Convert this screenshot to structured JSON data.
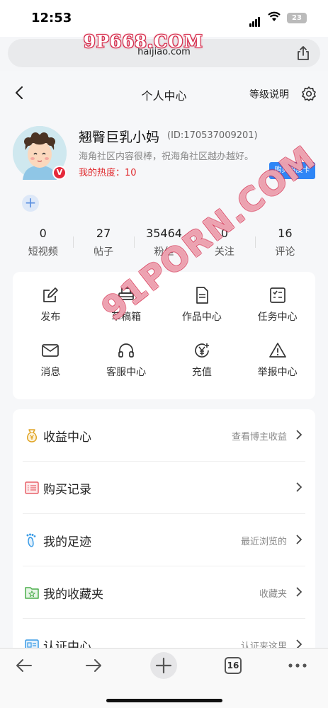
{
  "status_bar": {
    "time": "12:53",
    "battery": "23"
  },
  "browser": {
    "url": "haijiao.com",
    "watermark_top": "9P668.COM",
    "watermark_diagonal": "91PORN.COM",
    "tab_count": "16"
  },
  "header": {
    "title": "个人中心",
    "level_link": "等级说明"
  },
  "profile": {
    "username": "翘臀巨乳小妈",
    "user_id": "(ID:170537009201)",
    "bio": "海角社区内容很棒，祝海角社区越办越好。",
    "heat": "我的热度：10",
    "buy_card_label": "购买热度卡",
    "vip_badge": "V"
  },
  "stats": [
    {
      "value": "0",
      "label": "短视频"
    },
    {
      "value": "27",
      "label": "帖子"
    },
    {
      "value": "35464",
      "label": "粉丝"
    },
    {
      "value": "0",
      "label": "关注"
    },
    {
      "value": "16",
      "label": "评论"
    }
  ],
  "actions": [
    {
      "label": "发布",
      "icon": "edit-icon"
    },
    {
      "label": "草稿箱",
      "icon": "printer-icon"
    },
    {
      "label": "作品中心",
      "icon": "document-icon"
    },
    {
      "label": "任务中心",
      "icon": "checklist-icon"
    },
    {
      "label": "消息",
      "icon": "mail-icon"
    },
    {
      "label": "客服中心",
      "icon": "headset-icon"
    },
    {
      "label": "充值",
      "icon": "yen-coin-icon"
    },
    {
      "label": "举报中心",
      "icon": "warning-icon"
    }
  ],
  "menu": [
    {
      "label": "收益中心",
      "hint": "查看博主收益",
      "icon": "money-bag-icon",
      "color": "#e0a424"
    },
    {
      "label": "购买记录",
      "hint": "",
      "icon": "receipt-icon",
      "color": "#e8626a"
    },
    {
      "label": "我的足迹",
      "hint": "最近浏览的",
      "icon": "footprint-icon",
      "color": "#3a9be6"
    },
    {
      "label": "我的收藏夹",
      "hint": "收藏夹",
      "icon": "folder-star-icon",
      "color": "#4cae4c"
    },
    {
      "label": "认证中心",
      "hint": "认证来这里",
      "icon": "id-card-icon",
      "color": "#3a9be6"
    }
  ]
}
